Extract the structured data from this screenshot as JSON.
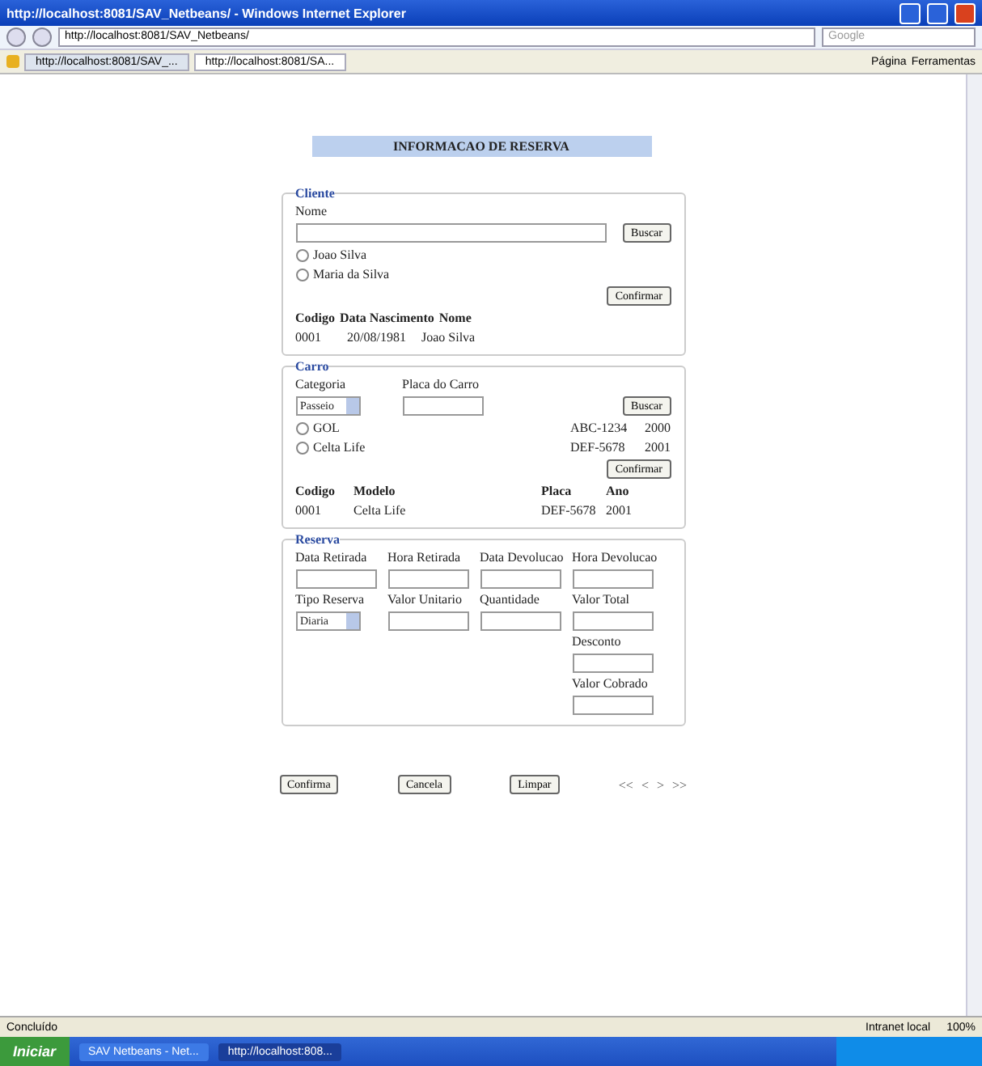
{
  "window": {
    "title": "http://localhost:8081/SAV_Netbeans/ - Windows Internet Explorer"
  },
  "address_bar": {
    "url": "http://localhost:8081/SAV_Netbeans/",
    "search_placeholder": "Google"
  },
  "tabs": [
    {
      "label": "http://localhost:8081/SAV_...",
      "selected": false
    },
    {
      "label": "http://localhost:8081/SA...",
      "selected": true
    }
  ],
  "command_bar": [
    "Página",
    "Ferramentas"
  ],
  "page": {
    "heading": "INFORMACAO DE RESERVA",
    "cliente": {
      "legend": "Cliente",
      "name_label": "Nome",
      "search_button": "Buscar",
      "options": [
        {
          "label": "Joao Silva",
          "selected": false
        },
        {
          "label": "Maria da Silva",
          "selected": false
        }
      ],
      "confirm_button": "Confirmar",
      "columns": [
        "Codigo",
        "Data Nascimento",
        "Nome"
      ],
      "row": [
        "0001",
        "20/08/1981",
        "Joao Silva"
      ]
    },
    "carro": {
      "legend": "Carro",
      "category_label": "Categoria",
      "category_value": "Passeio",
      "plate_label": "Placa do Carro",
      "search_button": "Buscar",
      "options": [
        {
          "label": "GOL",
          "plate": "ABC-1234",
          "year": "2000",
          "selected": false
        },
        {
          "label": "Celta Life",
          "plate": "DEF-5678",
          "year": "2001",
          "selected": false
        }
      ],
      "confirm_button": "Confirmar",
      "columns": [
        "Codigo",
        "Modelo",
        "Placa",
        "Ano"
      ],
      "row": [
        "0001",
        "Celta Life",
        "DEF-5678",
        "2001"
      ]
    },
    "reserva": {
      "legend": "Reserva",
      "fields": [
        {
          "label": "Data Retirada",
          "kind": "text"
        },
        {
          "label": "Hora Retirada",
          "kind": "text"
        },
        {
          "label": "Data Devolucao",
          "kind": "text"
        },
        {
          "label": "Hora Devolucao",
          "kind": "text"
        },
        {
          "label": "Tipo Reserva",
          "kind": "select",
          "value": "Diaria"
        },
        {
          "label": "Valor Unitario",
          "kind": "text"
        },
        {
          "label": "Quantidade",
          "kind": "text"
        },
        {
          "label": "Valor Total",
          "kind": "text"
        }
      ],
      "extra_fields": [
        {
          "label": "Desconto"
        },
        {
          "label": "Valor Cobrado"
        }
      ]
    },
    "buttons": [
      "Confirma",
      "Cancela",
      "Limpar"
    ],
    "pager": [
      "<<",
      "<",
      ">",
      ">>"
    ]
  },
  "status_bar": {
    "status": "Concluído",
    "zone": "Intranet local",
    "zoom": "100%"
  },
  "taskbar": {
    "start": "Iniciar",
    "items": [
      {
        "label": "SAV Netbeans - Net...",
        "selected": false
      },
      {
        "label": "http://localhost:808...",
        "selected": true
      }
    ]
  }
}
